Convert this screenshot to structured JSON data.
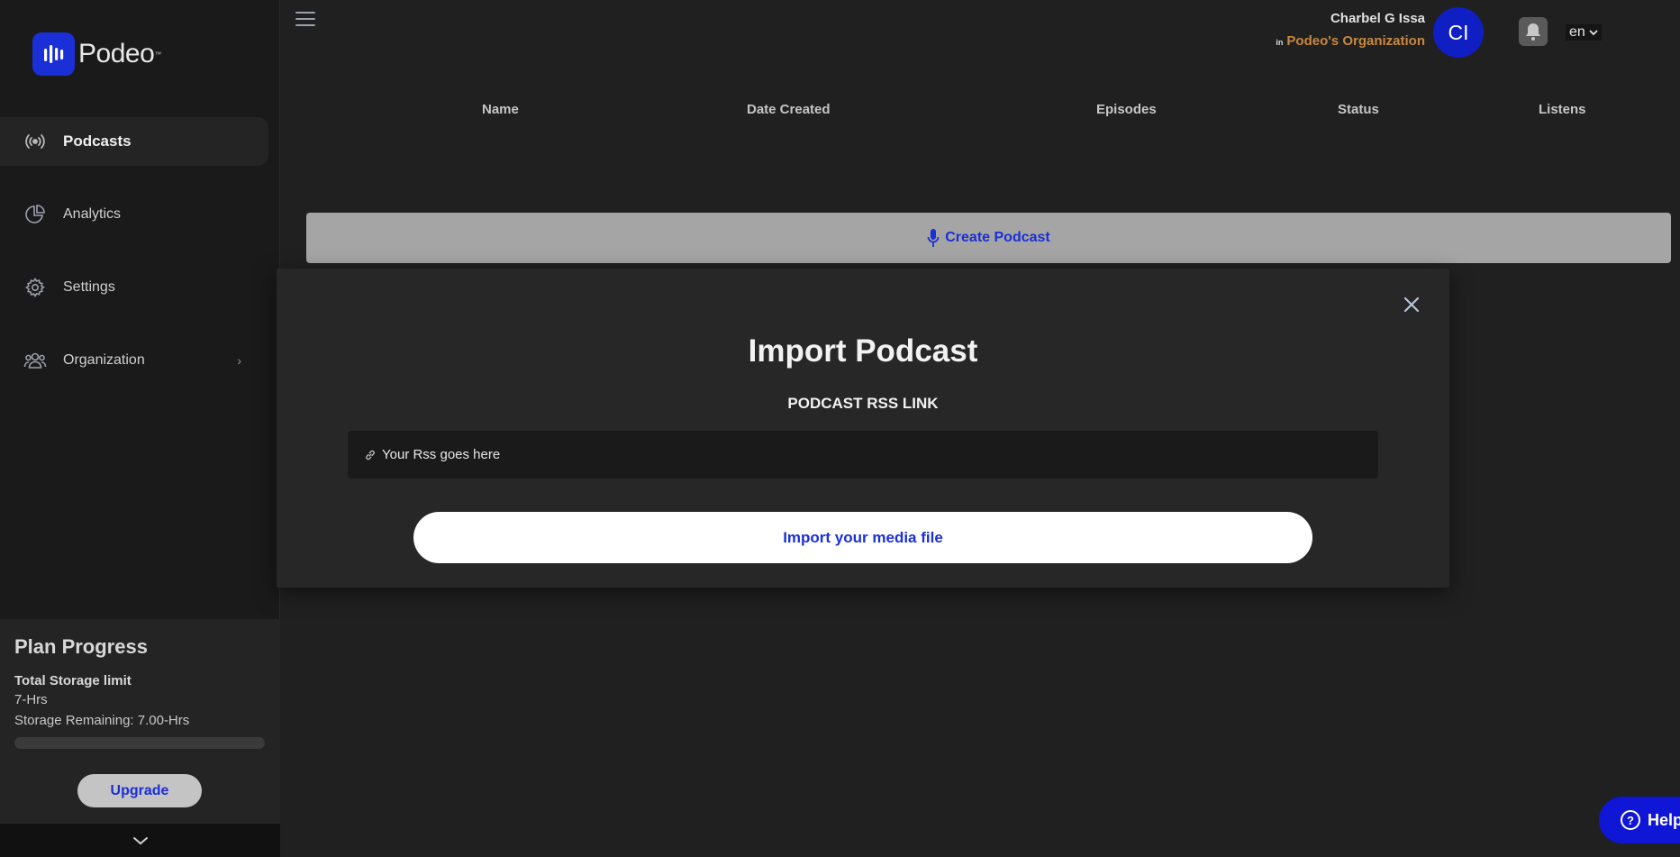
{
  "brand": {
    "name": "Podeo",
    "tm": "™",
    "color": "#1a2fd6"
  },
  "sidebar": {
    "items": [
      {
        "label": "Podcasts",
        "icon": "broadcast-icon",
        "active": true
      },
      {
        "label": "Analytics",
        "icon": "pie-chart-icon",
        "active": false
      },
      {
        "label": "Settings",
        "icon": "gear-icon",
        "active": false
      },
      {
        "label": "Organization",
        "icon": "people-icon",
        "active": false
      }
    ],
    "plan": {
      "title": "Plan Progress",
      "storage_label": "Total Storage limit",
      "storage_limit": "7-Hrs",
      "storage_remaining": "Storage Remaining: 7.00-Hrs",
      "usage_fraction": 0,
      "upgrade_label": "Upgrade"
    }
  },
  "header": {
    "user_name": "Charbel G Issa",
    "org_prefix": "in",
    "org_name": "Podeo's Organization",
    "avatar_initials": "CI",
    "language": "en"
  },
  "table": {
    "columns": [
      "Name",
      "Date Created",
      "Episodes",
      "Status",
      "Listens"
    ]
  },
  "create_button_label": "Create Podcast",
  "modal": {
    "title": "Import Podcast",
    "field_label": "PODCAST RSS LINK",
    "input_placeholder": "Your Rss goes here",
    "import_button": "Import your media file"
  },
  "help_label": "Help"
}
